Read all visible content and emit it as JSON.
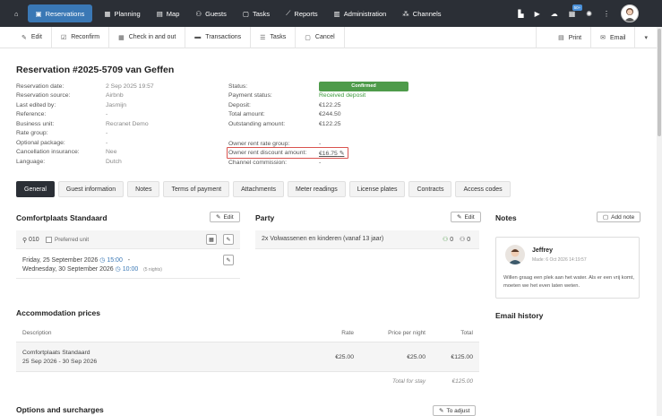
{
  "nav": {
    "items": [
      {
        "key": "home",
        "icon": "home-icon"
      },
      {
        "key": "reservations",
        "label": "Reservations",
        "icon": "reservations-icon",
        "active": true
      },
      {
        "key": "planning",
        "label": "Planning",
        "icon": "calendar-icon"
      },
      {
        "key": "map",
        "label": "Map",
        "icon": "map-icon"
      },
      {
        "key": "guests",
        "label": "Guests",
        "icon": "guests-icon"
      },
      {
        "key": "tasks",
        "label": "Tasks",
        "icon": "tasks-icon"
      },
      {
        "key": "reports",
        "label": "Reports",
        "icon": "chart-icon"
      },
      {
        "key": "administration",
        "label": "Administration",
        "icon": "building-icon"
      },
      {
        "key": "channels",
        "label": "Channels",
        "icon": "channels-icon"
      }
    ],
    "badge": "50+"
  },
  "toolbar": {
    "edit": "Edit",
    "reconfirm": "Reconfirm",
    "checkin": "Check in and out",
    "transactions": "Transactions",
    "tasks": "Tasks",
    "cancel": "Cancel",
    "print": "Print",
    "email": "Email"
  },
  "reservation": {
    "title": "Reservation #2025-5709 van Geffen",
    "left": [
      {
        "k": "Reservation date:",
        "v": "2 Sep 2025 19:57"
      },
      {
        "k": "Reservation source:",
        "v": "Airbnb"
      },
      {
        "k": "Last edited by:",
        "v": "Jasmijn"
      },
      {
        "k": "Reference:",
        "v": "-"
      },
      {
        "k": "Business unit:",
        "v": "Recranet Demo"
      },
      {
        "k": "Rate group:",
        "v": "-"
      },
      {
        "k": "Optional package:",
        "v": "-"
      },
      {
        "k": "Cancellation insurance:",
        "v": "Nee"
      },
      {
        "k": "Language:",
        "v": "Dutch"
      }
    ],
    "status_label": "Status:",
    "status": "Confirmed",
    "right": [
      {
        "k": "Payment status:",
        "v": "Received deposit"
      },
      {
        "k": "Deposit:",
        "v": "€122.25"
      },
      {
        "k": "Total amount:",
        "v": "€244.50"
      },
      {
        "k": "Outstanding amount:",
        "v": "€122.25"
      }
    ],
    "owner": [
      {
        "k": "Owner rent rate group:",
        "v": "-"
      },
      {
        "k": "Owner rent discount amount:",
        "v": "€16.75"
      },
      {
        "k": "Channel commission:",
        "v": "-"
      }
    ]
  },
  "tabs": [
    "General",
    "Guest information",
    "Notes",
    "Terms of payment",
    "Attachments",
    "Meter readings",
    "License plates",
    "Contracts",
    "Access codes"
  ],
  "unit": {
    "title": "Comfortplaats Standaard",
    "edit": "Edit",
    "number": "010",
    "preferred": "Preferred unit",
    "date1": "Friday, 25 September 2026",
    "time1": "15:00",
    "dash": "-",
    "date2": "Wednesday, 30 September 2026",
    "time2": "10:00",
    "nights": "(5 nights)"
  },
  "party": {
    "title": "Party",
    "edit": "Edit",
    "desc": "2x Volwassenen en kinderen (vanaf 13 jaar)",
    "c1": "0",
    "c2": "0"
  },
  "notes": {
    "title": "Notes",
    "add": "Add note",
    "author": "Jeffrey",
    "meta": "Made: 6 Oct 2026 14:19:57",
    "text": "Willen graag een plek aan het water. Als er een vrij komt, moeten we het even laten weten."
  },
  "email_history": "Email history",
  "prices": {
    "title": "Accommodation prices",
    "headers": [
      "Description",
      "Rate",
      "Price per night",
      "Total"
    ],
    "row_name": "Comfortplaats Standaard",
    "row_dates": "25 Sep 2026 - 30 Sep 2026",
    "rate": "€25.00",
    "ppn": "€25.00",
    "total": "€125.00",
    "footer_label": "Total for stay",
    "footer_value": "€125.00"
  },
  "options": {
    "title": "Options and surcharges",
    "adjust": "To adjust"
  }
}
